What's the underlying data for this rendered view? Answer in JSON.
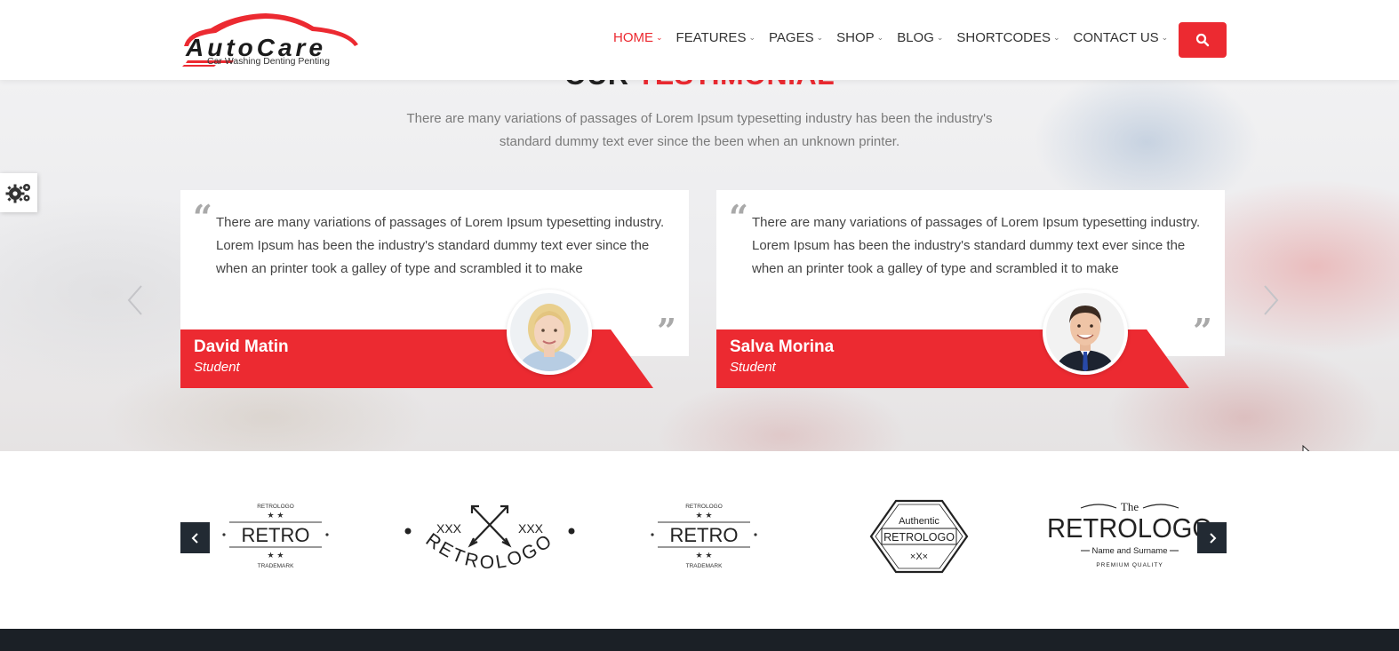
{
  "header": {
    "logo": {
      "wordmark": "AutoCare",
      "tagline": "Car Washing Denting Penting"
    },
    "nav": [
      {
        "label": "HOME",
        "active": true
      },
      {
        "label": "FEATURES",
        "active": false
      },
      {
        "label": "PAGES",
        "active": false
      },
      {
        "label": "SHOP",
        "active": false
      },
      {
        "label": "BLOG",
        "active": false
      },
      {
        "label": "SHORTCODES",
        "active": false
      },
      {
        "label": "CONTACT US",
        "active": false
      }
    ],
    "search_icon": "search-icon"
  },
  "testimonial": {
    "title_part1": "OUR ",
    "title_part2": "TESTIMONIAL",
    "description": "There are many variations of passages of Lorem Ipsum typesetting industry has been the industry's standard dummy text ever since the been when an unknown printer.",
    "cards": [
      {
        "text": "There are many variations of passages of Lorem Ipsum typesetting industry. Lorem Ipsum has been the industry's standard dummy text ever since the when an printer took a galley of type and scrambled it to make",
        "name": "David Matin",
        "role": "Student",
        "avatar": "woman-avatar"
      },
      {
        "text": "There are many variations of passages of Lorem Ipsum typesetting industry. Lorem Ipsum has been the industry's standard dummy text ever since the when an printer took a galley of type and scrambled it to make",
        "name": "Salva Morina",
        "role": "Student",
        "avatar": "man-avatar"
      }
    ]
  },
  "brands": {
    "logos": [
      {
        "top": "RETROLOGO",
        "main": "RETRO",
        "bottom": "TRADEMARK"
      },
      {
        "main": "RETROLOGO",
        "marks": "XXX"
      },
      {
        "top": "RETROLOGO",
        "main": "RETRO",
        "bottom": "TRADEMARK"
      },
      {
        "top": "Authentic",
        "main": "RETROLOGO",
        "bottom": "×X×"
      },
      {
        "top": "The",
        "main": "RETROLOGO",
        "sub": "Name and Surname",
        "bottom": "PREMIUM QUALITY"
      }
    ]
  },
  "colors": {
    "accent": "#ec2a31",
    "dark": "#222a33"
  }
}
